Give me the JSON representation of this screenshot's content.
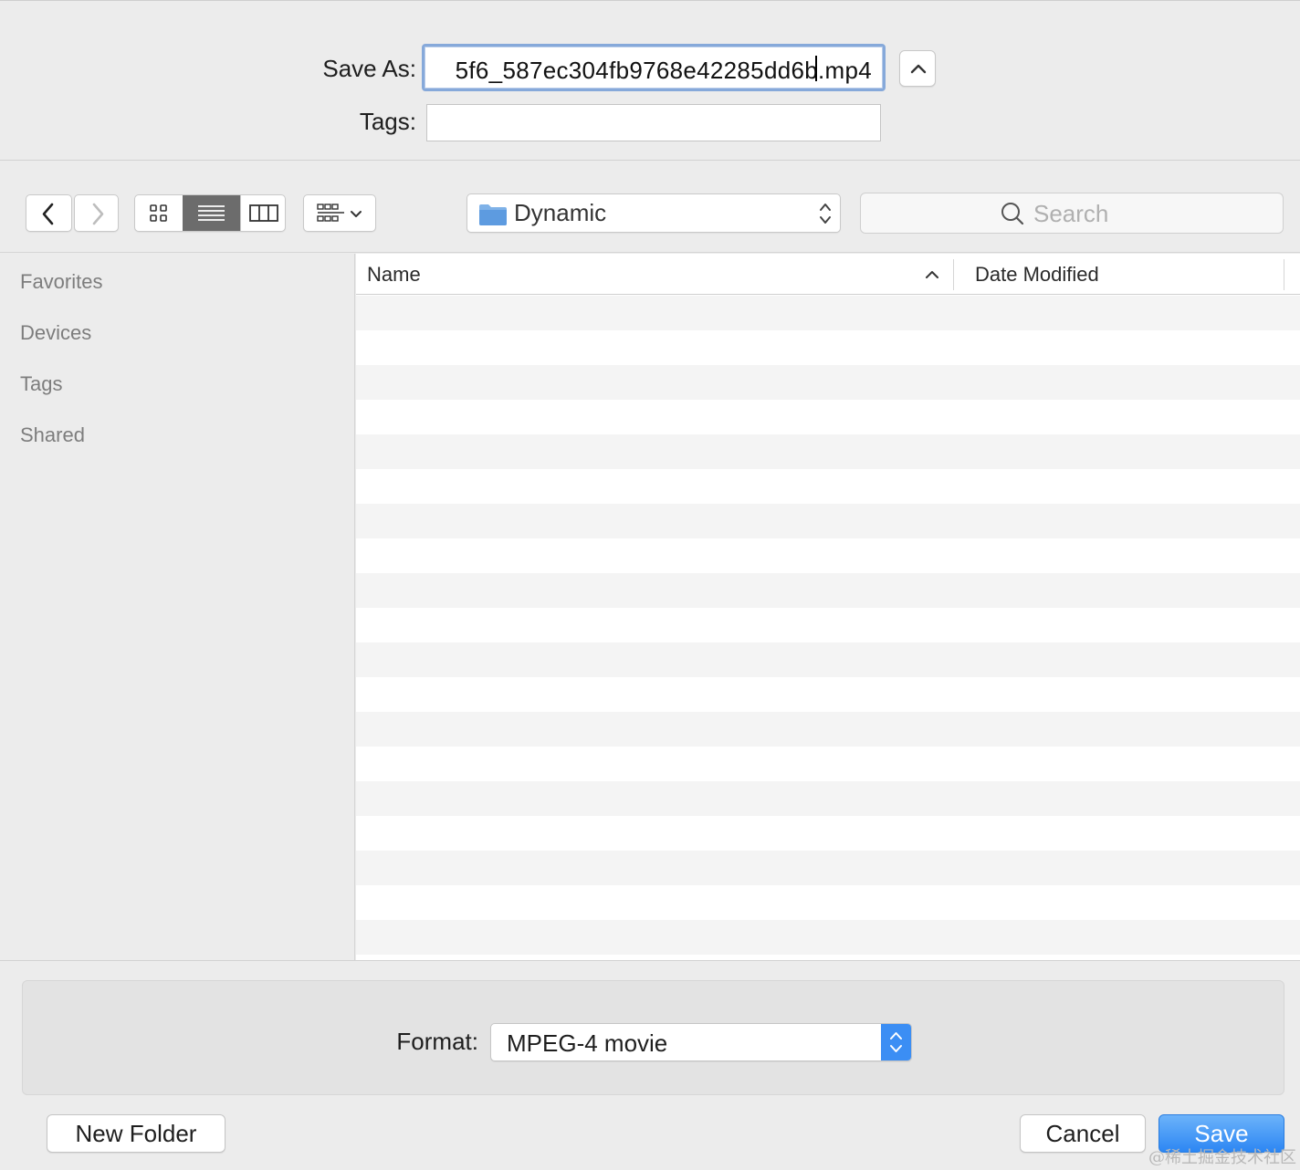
{
  "header": {
    "save_as_label": "Save As:",
    "save_as_value": "5f6_587ec304fb9768e42285dd6b.mp4",
    "tags_label": "Tags:",
    "tags_value": "",
    "expand_icon": "chevron-up-icon"
  },
  "toolbar": {
    "back_icon": "chevron-left-icon",
    "forward_icon": "chevron-right-icon",
    "view_modes": [
      "icon-view",
      "list-view",
      "column-view"
    ],
    "selected_view": "list-view",
    "group_icon": "group-by-icon",
    "location": "Dynamic",
    "location_icon": "folder-icon",
    "search_placeholder": "Search"
  },
  "sidebar": {
    "items": [
      {
        "label": "Favorites"
      },
      {
        "label": "Devices"
      },
      {
        "label": "Tags"
      },
      {
        "label": "Shared"
      }
    ]
  },
  "file_list": {
    "columns": [
      "Name",
      "Date Modified"
    ],
    "sort_column": "Name",
    "sort_direction": "ascending",
    "rows": []
  },
  "footer": {
    "format_label": "Format:",
    "format_value": "MPEG-4 movie",
    "new_folder_label": "New Folder",
    "cancel_label": "Cancel",
    "save_label": "Save",
    "watermark": "@稀土掘金技术社区"
  },
  "colors": {
    "accent": "#3b8ef4",
    "focus_ring": "#86a9da",
    "window_bg": "#ececec"
  }
}
